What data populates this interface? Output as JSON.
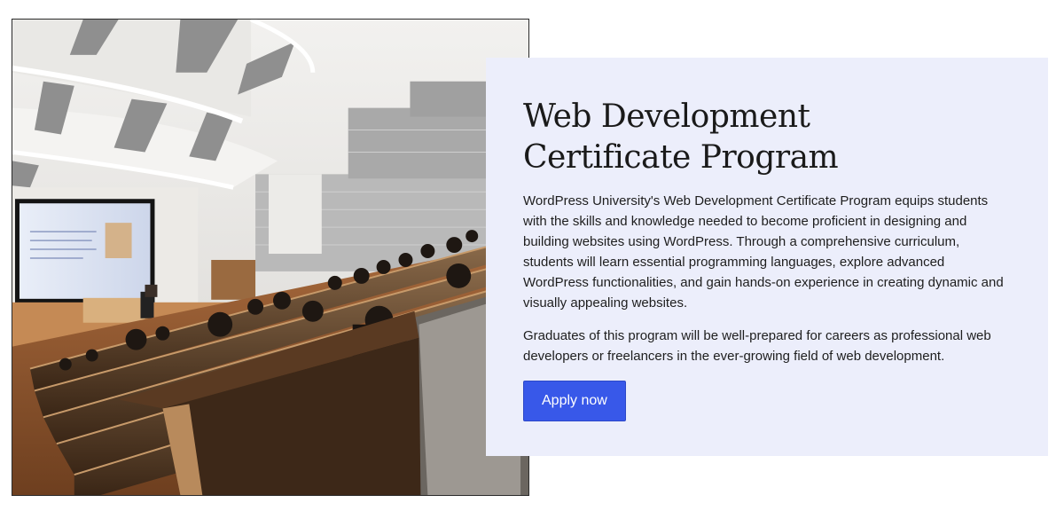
{
  "hero": {
    "image_alt": "Lecture hall with students watching a presentation"
  },
  "card": {
    "title": "Web Development Certificate Program",
    "paragraphs": [
      "WordPress University's Web Development Certificate Program equips students with the skills and knowledge needed to become proficient in designing and building websites using WordPress. Through a comprehensive curriculum, students will learn essential programming languages, explore advanced WordPress functionalities, and gain hands-on experience in creating dynamic and visually appealing websites.",
      "Graduates of this program will be well-prepared for careers as professional web developers or freelancers in the ever-growing field of web development."
    ],
    "button_label": "Apply now"
  },
  "colors": {
    "card_background": "#eceefb",
    "button_background": "#3858e9",
    "button_text": "#ffffff"
  }
}
